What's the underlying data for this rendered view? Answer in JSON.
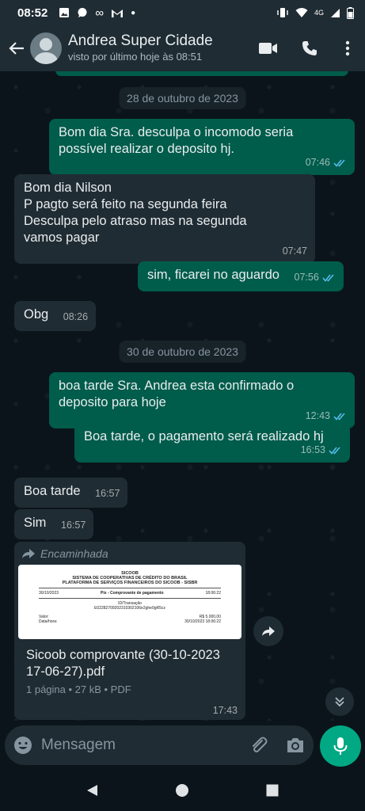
{
  "status_bar": {
    "time": "08:52",
    "network": "4G"
  },
  "header": {
    "contact_name": "Andrea Super Cidade",
    "contact_status": "visto por último hoje às 08:51"
  },
  "chat": {
    "date_1": "28 de outubro de 2023",
    "date_2": "30 de outubro de 2023",
    "messages": [
      {
        "text": "Bom dia Sra. desculpa o incomodo seria\npossível realizar o deposito hj.",
        "time": "07:46"
      },
      {
        "text": "Bom dia Nilson\nP pagto será feito na segunda feira\nDesculpa pelo atraso mas na segunda\nvamos pagar",
        "time": "07:47"
      },
      {
        "text": "sim, ficarei no aguardo",
        "time": "07:56"
      },
      {
        "text": "Obg",
        "time": "08:26"
      },
      {
        "text": "boa tarde Sra. Andrea esta confirmado o\ndeposito para hoje",
        "time": "12:43"
      },
      {
        "text": "Boa tarde, o pagamento será realizado hj",
        "time": "16:53"
      },
      {
        "text": "Boa tarde",
        "time": "16:57"
      },
      {
        "text": "Sim",
        "time": "16:57"
      }
    ],
    "document": {
      "forwarded_label": "Encaminhada",
      "preview": {
        "bank": "SICOOB",
        "line1": "SISTEMA DE COOPERATIVAS DE CRÉDITO DO BRASIL",
        "line2": "PLATAFORMA DE SERVIÇOS FINANCEIROS DO SICOOB - SISBR",
        "date": "30/10/2023",
        "heading": "Pix - Comprovante de pagamento",
        "hour": "18:06:22",
        "id_label": "ID/Transação",
        "id_value": "E02282709202310302106e2ghe0gR5cz",
        "valor_label": "Valor:",
        "valor": "R$ 5.000,00",
        "datahora_label": "Data/hora:",
        "datahora": "30/10/2023 18:06:22"
      },
      "filename": "Sicoob comprovante (30-10-2023\n17-06-27).pdf",
      "info": "1 página • 27 kB • PDF",
      "time": "17:43"
    }
  },
  "input": {
    "placeholder": "Mensagem"
  },
  "colors": {
    "outgoing": "#005c4b",
    "incoming": "#202c33",
    "accent": "#00a884",
    "read_ticks": "#53bdeb"
  }
}
